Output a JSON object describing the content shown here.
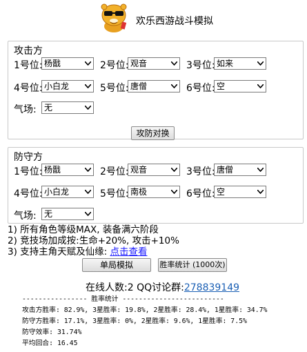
{
  "header": {
    "title": "欢乐西游战斗模拟"
  },
  "attack": {
    "title": "攻击方",
    "slots": [
      {
        "label": "1号位:",
        "value": "杨戬"
      },
      {
        "label": "2号位:",
        "value": "观音"
      },
      {
        "label": "3号位:",
        "value": "如来"
      },
      {
        "label": "4号位:",
        "value": "小白龙"
      },
      {
        "label": "5号位:",
        "value": "唐僧"
      },
      {
        "label": "6号位:",
        "value": "空"
      }
    ],
    "field": {
      "label": "气场:",
      "value": "无"
    }
  },
  "swap_button": "攻防对换",
  "defense": {
    "title": "防守方",
    "slots": [
      {
        "label": "1号位:",
        "value": "杨戬"
      },
      {
        "label": "2号位:",
        "value": "观音"
      },
      {
        "label": "3号位:",
        "value": "唐僧"
      },
      {
        "label": "4号位:",
        "value": "小白龙"
      },
      {
        "label": "5号位:",
        "value": "南极"
      },
      {
        "label": "6号位:",
        "value": "空"
      }
    ],
    "field": {
      "label": "气场:",
      "value": "无"
    }
  },
  "notes": [
    "1) 所有角色等级MAX, 装备满六阶段",
    "2) 竞技场加成按:生命+20%, 攻击+10%",
    "3) 支持主角天赋及仙缘:"
  ],
  "notes_link": "点击查看",
  "buttons": {
    "single": "单局模拟",
    "stats": "胜率统计 (1000次)"
  },
  "online": {
    "text": "在线人数:2 QQ讨论群:",
    "qq": "278839149"
  },
  "stats": {
    "header": "---------------- 胜率统计 -------------------------",
    "attack_line": "攻击方胜率: 82.9%, 3星胜率: 19.8%, 2星胜率: 28.4%, 1星胜率: 34.7%",
    "defense_line": "防守方胜率: 17.1%, 3星胜率: 0%, 2星胜率: 9.6%, 1星胜率: 7.5%",
    "efficiency": "防守效率: 31.74%",
    "avg_rounds": "平均回合: 16.45"
  }
}
